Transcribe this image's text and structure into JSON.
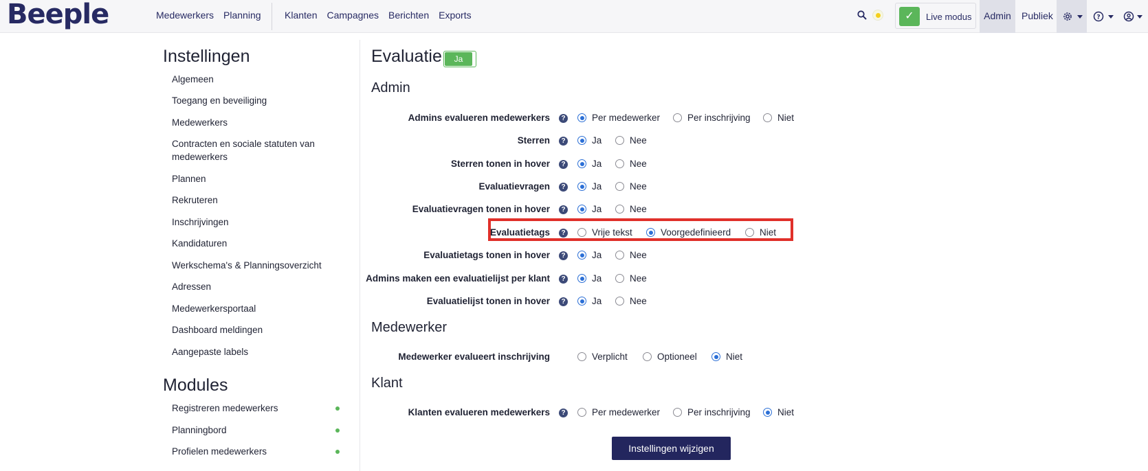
{
  "header": {
    "logo": "Beeple",
    "nav_left": [
      "Medewerkers",
      "Planning"
    ],
    "nav_mid": [
      "Klanten",
      "Campagnes",
      "Berichten",
      "Exports"
    ],
    "live_mode_label": "Live modus",
    "admin_label": "Admin",
    "publiek_label": "Publiek",
    "icons": [
      "search-icon",
      "sun-icon",
      "check-icon",
      "gear-icon",
      "help-circle-icon",
      "user-circle-icon"
    ]
  },
  "sidebar": {
    "settings_title": "Instellingen",
    "settings_items": [
      "Algemeen",
      "Toegang en beveiliging",
      "Medewerkers",
      "Contracten en sociale statuten van medewerkers",
      "Plannen",
      "Rekruteren",
      "Inschrijvingen",
      "Kandidaturen",
      "Werkschema's & Planningsoverzicht",
      "Adressen",
      "Medewerkersportaal",
      "Dashboard meldingen",
      "Aangepaste labels"
    ],
    "modules_title": "Modules",
    "module_items": [
      "Registreren medewerkers",
      "Planningbord",
      "Profielen medewerkers"
    ]
  },
  "main": {
    "title": "Evaluatie",
    "toggle_label": "Ja",
    "sections": {
      "admin": "Admin",
      "medewerker": "Medewerker",
      "klant": "Klant"
    },
    "rows": [
      {
        "label": "Admins evalueren medewerkers",
        "help": true,
        "options": [
          "Per medewerker",
          "Per inschrijving",
          "Niet"
        ],
        "selected": 0
      },
      {
        "label": "Sterren",
        "help": true,
        "options": [
          "Ja",
          "Nee"
        ],
        "selected": 0
      },
      {
        "label": "Sterren tonen in hover",
        "help": true,
        "options": [
          "Ja",
          "Nee"
        ],
        "selected": 0
      },
      {
        "label": "Evaluatievragen",
        "help": true,
        "options": [
          "Ja",
          "Nee"
        ],
        "selected": 0
      },
      {
        "label": "Evaluatievragen tonen in hover",
        "help": true,
        "options": [
          "Ja",
          "Nee"
        ],
        "selected": 0
      },
      {
        "label": "Evaluatietags",
        "help": true,
        "options": [
          "Vrije tekst",
          "Voorgedefinieerd",
          "Niet"
        ],
        "selected": 1
      },
      {
        "label": "Evaluatietags tonen in hover",
        "help": true,
        "options": [
          "Ja",
          "Nee"
        ],
        "selected": 0
      },
      {
        "label": "Admins maken een evaluatielijst per klant",
        "help": true,
        "options": [
          "Ja",
          "Nee"
        ],
        "selected": 0
      },
      {
        "label": "Evaluatielijst tonen in hover",
        "help": true,
        "options": [
          "Ja",
          "Nee"
        ],
        "selected": 0
      },
      {
        "label": "Medewerker evalueert inschrijving",
        "help": false,
        "options": [
          "Verplicht",
          "Optioneel",
          "Niet"
        ],
        "selected": 2
      },
      {
        "label": "Klanten evalueren medewerkers",
        "help": true,
        "options": [
          "Per medewerker",
          "Per inschrijving",
          "Niet"
        ],
        "selected": 2
      }
    ],
    "help_glyph": "?",
    "submit_label": "Instellingen wijzigen"
  },
  "colors": {
    "brand": "#272a63",
    "accent_green": "#5bb65a",
    "radio_blue": "#2b6fd6",
    "highlight_red": "#e0302a"
  }
}
